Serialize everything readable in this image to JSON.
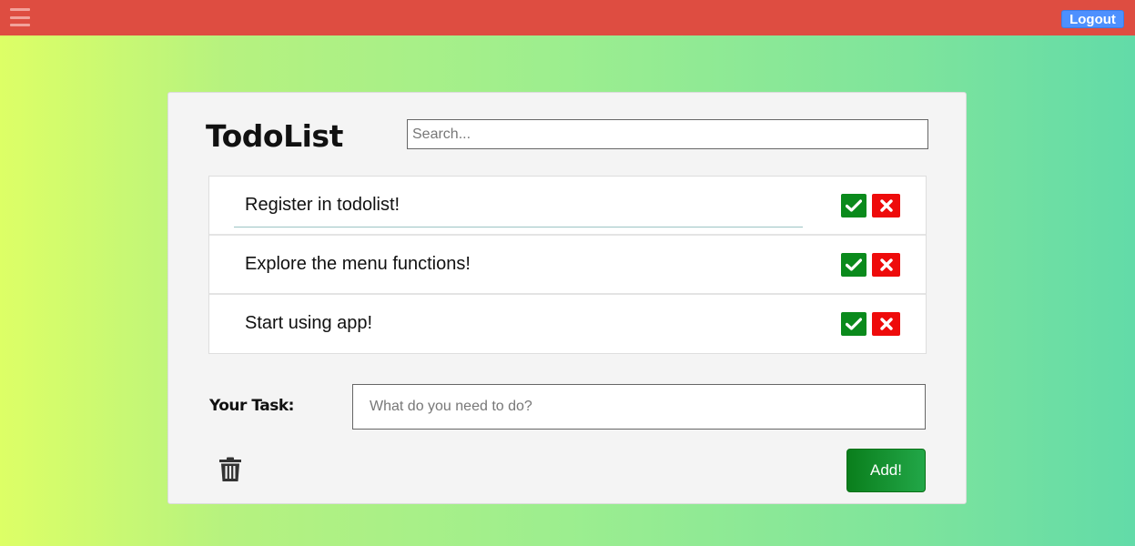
{
  "header": {
    "menu_icon": "hamburger-menu-icon",
    "logout_label": "Logout",
    "bar_color": "#de4d41",
    "logout_color": "#4d90fe"
  },
  "app": {
    "title": "TodoList",
    "search_placeholder": "Search..."
  },
  "todos": [
    {
      "text": "Register in todolist!"
    },
    {
      "text": "Explore the menu functions!"
    },
    {
      "text": "Start using app!"
    }
  ],
  "icons": {
    "done": "check-icon",
    "delete": "x-icon",
    "clear": "trash-icon"
  },
  "colors": {
    "done_button": "#0a8a1c",
    "delete_button": "#ee0b0b",
    "add_button": "#0a7e1c"
  },
  "form": {
    "task_label": "Your Task:",
    "task_placeholder": "What do you need to do?",
    "add_label": "Add!"
  }
}
